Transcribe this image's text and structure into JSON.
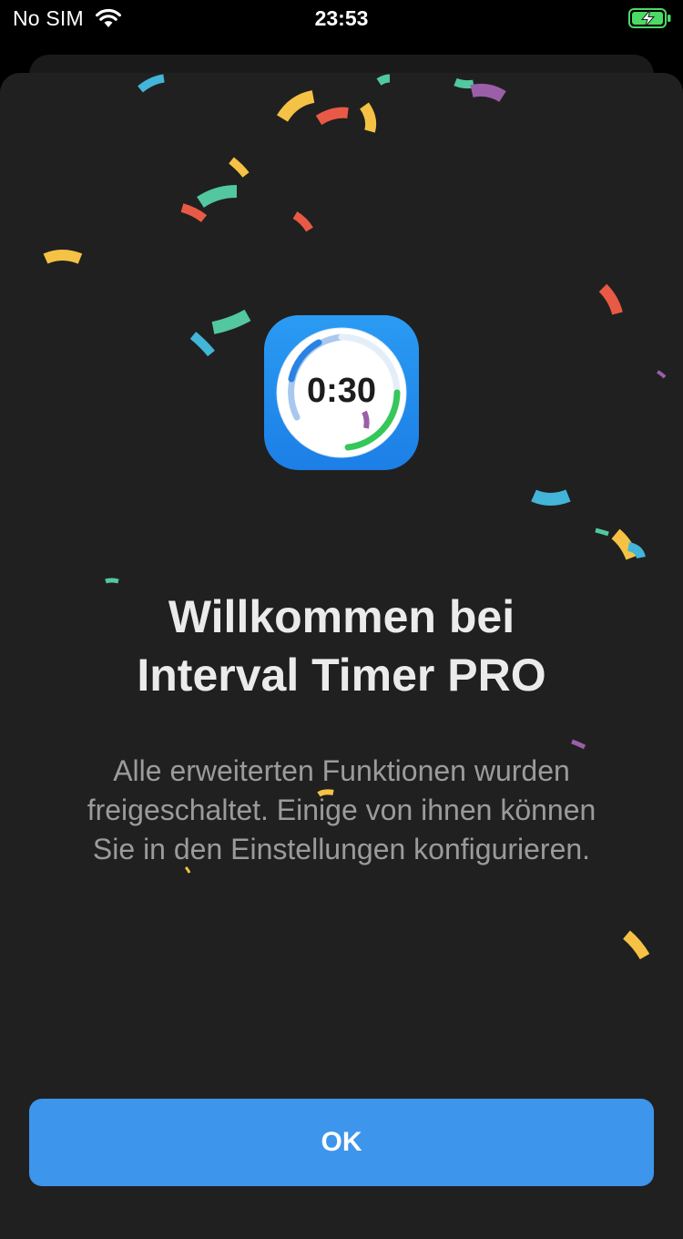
{
  "status_bar": {
    "carrier": "No SIM",
    "time": "23:53",
    "icons": [
      "wifi-icon",
      "battery-charging-icon"
    ]
  },
  "app_icon": {
    "timer_text": "0:30",
    "icon": "interval-timer-app-icon"
  },
  "welcome": {
    "title_lines": [
      "Willkommen bei",
      "Interval Timer PRO"
    ],
    "message_lines": [
      "Alle erweiterten Funktionen wurden",
      "freigeschaltet. Einige von ihnen können",
      "Sie in den Einstellungen konfigurieren."
    ]
  },
  "actions": {
    "ok_label": "OK"
  },
  "colors": {
    "background": "#202020",
    "accent": "#3d95ec",
    "title": "#ebebeb",
    "message": "#9b9b9b",
    "confetti": [
      "#f5c245",
      "#e85a45",
      "#52c7a0",
      "#43b5d8",
      "#9a5fa8"
    ]
  }
}
